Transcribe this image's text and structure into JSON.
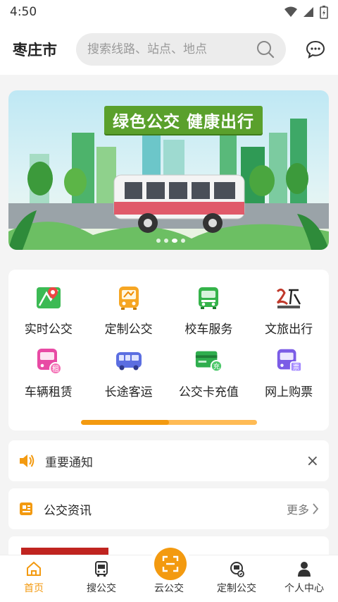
{
  "status": {
    "time": "4:50"
  },
  "header": {
    "city": "枣庄市",
    "search_placeholder": "搜索线路、站点、地点"
  },
  "banner": {
    "slogan": "绿色公交   健康出行",
    "slide_count": 4,
    "active_slide": 3
  },
  "grid": [
    {
      "label": "实时公交",
      "icon": "map-pin-icon",
      "color": "#3cba54"
    },
    {
      "label": "定制公交",
      "icon": "bus-front-icon",
      "color": "#f6a623"
    },
    {
      "label": "校车服务",
      "icon": "school-bus-icon",
      "color": "#35b34a"
    },
    {
      "label": "文旅出行",
      "icon": "culture-travel-logo-icon",
      "color": "#c0392b"
    },
    {
      "label": "车辆租赁",
      "icon": "rental-bus-icon",
      "color": "#e84aa4"
    },
    {
      "label": "长途客运",
      "icon": "coach-icon",
      "color": "#5b6ee1"
    },
    {
      "label": "公交卡充值",
      "icon": "card-recharge-icon",
      "color": "#2fae4e"
    },
    {
      "label": "网上购票",
      "icon": "ticket-bus-icon",
      "color": "#7b5ce6"
    }
  ],
  "grid_scroll_progress": 0.5,
  "notice": {
    "text": "重要通知",
    "close": "×"
  },
  "news": {
    "title": "公交资讯",
    "more": "更多"
  },
  "tabbar": [
    {
      "label": "首页",
      "icon": "home-icon",
      "active": true
    },
    {
      "label": "搜公交",
      "icon": "bus-search-icon",
      "active": false
    },
    {
      "label": "云公交",
      "icon": "scan-icon",
      "active": false
    },
    {
      "label": "定制公交",
      "icon": "custom-bus-icon",
      "active": false
    },
    {
      "label": "个人中心",
      "icon": "person-icon",
      "active": false
    }
  ],
  "colors": {
    "accent": "#f39a10",
    "banner_green": "#5aa02c"
  }
}
